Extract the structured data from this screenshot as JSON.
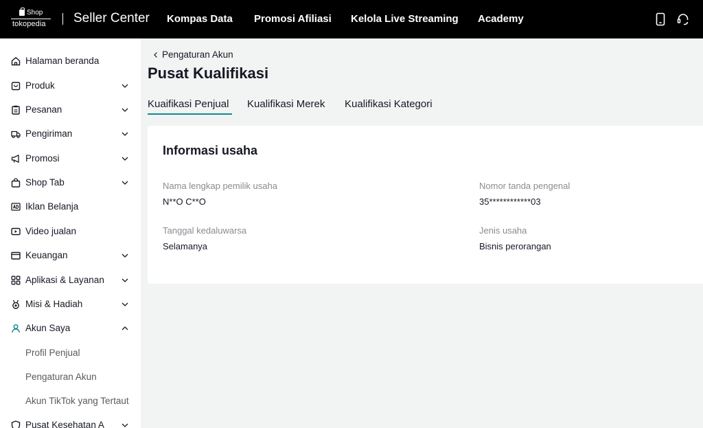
{
  "header": {
    "logo_shop": "Shop",
    "logo_brand": "tokopedia",
    "title": "Seller Center",
    "nav": [
      "Kompas Data",
      "Promosi Afiliasi",
      "Kelola Live Streaming",
      "Academy"
    ],
    "icons": [
      "phone-icon",
      "headset-icon"
    ]
  },
  "sidebar": {
    "items": [
      {
        "label": "Halaman beranda",
        "icon": "home-icon",
        "chevron": "none"
      },
      {
        "label": "Produk",
        "icon": "product-icon",
        "chevron": "down"
      },
      {
        "label": "Pesanan",
        "icon": "clipboard-icon",
        "chevron": "down"
      },
      {
        "label": "Pengiriman",
        "icon": "truck-icon",
        "chevron": "down"
      },
      {
        "label": "Promosi",
        "icon": "megaphone-icon",
        "chevron": "down"
      },
      {
        "label": "Shop Tab",
        "icon": "shop-bag-icon",
        "chevron": "down"
      },
      {
        "label": "Iklan Belanja",
        "icon": "ad-icon",
        "chevron": "none"
      },
      {
        "label": "Video jualan",
        "icon": "video-icon",
        "chevron": "none"
      },
      {
        "label": "Keuangan",
        "icon": "wallet-icon",
        "chevron": "down"
      },
      {
        "label": "Aplikasi & Layanan",
        "icon": "apps-icon",
        "chevron": "down"
      },
      {
        "label": "Misi & Hadiah",
        "icon": "medal-icon",
        "chevron": "down"
      },
      {
        "label": "Akun Saya",
        "icon": "user-icon",
        "chevron": "up"
      }
    ],
    "subitems": [
      "Profil Penjual",
      "Pengaturan Akun",
      "Akun TikTok yang Tertaut"
    ],
    "last_item": {
      "label": "Pusat Kesehatan A",
      "icon": "shield-icon",
      "chevron": "down"
    }
  },
  "main": {
    "breadcrumb": "Pengaturan Akun",
    "title": "Pusat Kualifikasi",
    "tabs": [
      "Kuaifikasi Penjual",
      "Kualifikasi Merek",
      "Kualifikasi Kategori"
    ],
    "active_tab": "Kuaifikasi Penjual",
    "card": {
      "title": "Informasi usaha",
      "fields": [
        {
          "label": "Nama lengkap pemilik usaha",
          "value": "N**O C**O"
        },
        {
          "label": "Nomor tanda pengenal",
          "value": "35************03"
        },
        {
          "label": "Tanggal kedaluwarsa",
          "value": "Selamanya"
        },
        {
          "label": "Jenis usaha",
          "value": "Bisnis perorangan"
        }
      ]
    }
  },
  "colors": {
    "topbar": "#000000",
    "accent": "#0f8a8f",
    "background": "#f2f3f3",
    "card": "#ffffff"
  }
}
